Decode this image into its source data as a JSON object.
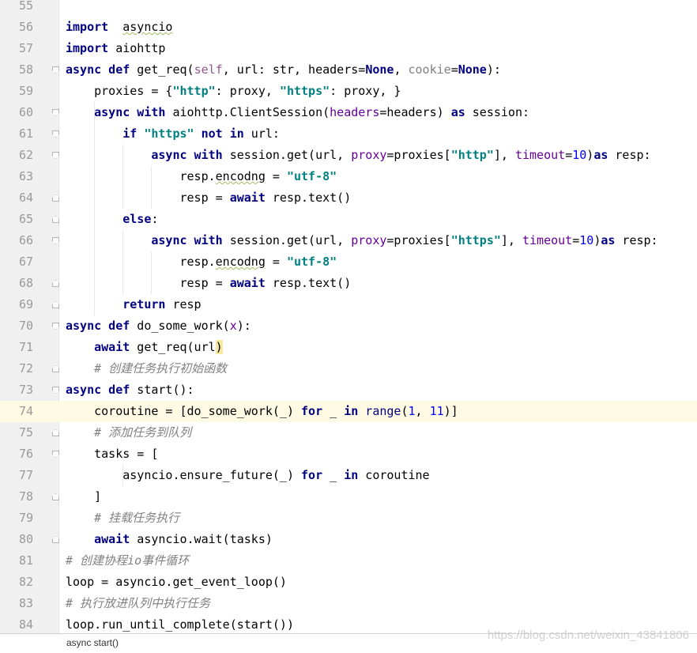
{
  "editor": {
    "current_line": 74,
    "lines": [
      {
        "n": "55",
        "segs": []
      },
      {
        "n": "56",
        "segs": [
          [
            "kw",
            "import"
          ],
          [
            "",
            "  "
          ],
          [
            "squig",
            "asyncio"
          ]
        ]
      },
      {
        "n": "57",
        "segs": [
          [
            "kw",
            "import"
          ],
          [
            "",
            " aiohttp"
          ]
        ]
      },
      {
        "n": "58",
        "segs": [
          [
            "kw",
            "async def"
          ],
          [
            "",
            " get_req("
          ],
          [
            "self",
            "self"
          ],
          [
            "",
            ", url: str, headers="
          ],
          [
            "kw",
            "None"
          ],
          [
            "",
            ", "
          ],
          [
            "grey",
            "cookie"
          ],
          [
            "",
            "="
          ],
          [
            "kw",
            "None"
          ],
          [
            "",
            "):"
          ]
        ]
      },
      {
        "n": "59",
        "segs": [
          [
            "",
            "    proxies = {"
          ],
          [
            "str",
            "\"http\""
          ],
          [
            "",
            ": proxy, "
          ],
          [
            "str",
            "\"https\""
          ],
          [
            "",
            ": proxy, }"
          ]
        ]
      },
      {
        "n": "60",
        "segs": [
          [
            "",
            "    "
          ],
          [
            "kw",
            "async with"
          ],
          [
            "",
            " aiohttp.ClientSession("
          ],
          [
            "param",
            "headers"
          ],
          [
            "",
            "=headers) "
          ],
          [
            "kw",
            "as"
          ],
          [
            "",
            " session:"
          ]
        ]
      },
      {
        "n": "61",
        "segs": [
          [
            "",
            "        "
          ],
          [
            "kw",
            "if"
          ],
          [
            "",
            " "
          ],
          [
            "str",
            "\"https\""
          ],
          [
            "",
            " "
          ],
          [
            "kw",
            "not in"
          ],
          [
            "",
            " url:"
          ]
        ]
      },
      {
        "n": "62",
        "segs": [
          [
            "",
            "            "
          ],
          [
            "kw",
            "async with"
          ],
          [
            "",
            " session.get(url, "
          ],
          [
            "param",
            "proxy"
          ],
          [
            "",
            "=proxies["
          ],
          [
            "str",
            "\"http\""
          ],
          [
            "",
            "], "
          ],
          [
            "param",
            "timeout"
          ],
          [
            "",
            "="
          ],
          [
            "num",
            "10"
          ],
          [
            "",
            ")"
          ],
          [
            "kw",
            "as"
          ],
          [
            "",
            " resp:"
          ]
        ]
      },
      {
        "n": "63",
        "segs": [
          [
            "",
            "                resp."
          ],
          [
            "squig",
            "encodng"
          ],
          [
            "",
            " = "
          ],
          [
            "str",
            "\"utf-8\""
          ]
        ]
      },
      {
        "n": "64",
        "segs": [
          [
            "",
            "                resp = "
          ],
          [
            "kw",
            "await"
          ],
          [
            "",
            " resp.text()"
          ]
        ]
      },
      {
        "n": "65",
        "segs": [
          [
            "",
            "        "
          ],
          [
            "kw",
            "else"
          ],
          [
            "",
            ":"
          ]
        ]
      },
      {
        "n": "66",
        "segs": [
          [
            "",
            "            "
          ],
          [
            "kw",
            "async with"
          ],
          [
            "",
            " session.get(url, "
          ],
          [
            "param",
            "proxy"
          ],
          [
            "",
            "=proxies["
          ],
          [
            "str",
            "\"https\""
          ],
          [
            "",
            "], "
          ],
          [
            "param",
            "timeout"
          ],
          [
            "",
            "="
          ],
          [
            "num",
            "10"
          ],
          [
            "",
            ")"
          ],
          [
            "kw",
            "as"
          ],
          [
            "",
            " resp:"
          ]
        ]
      },
      {
        "n": "67",
        "segs": [
          [
            "",
            "                resp."
          ],
          [
            "squig",
            "encodng"
          ],
          [
            "",
            " = "
          ],
          [
            "str",
            "\"utf-8\""
          ]
        ]
      },
      {
        "n": "68",
        "segs": [
          [
            "",
            "                resp = "
          ],
          [
            "kw",
            "await"
          ],
          [
            "",
            " resp.text()"
          ]
        ]
      },
      {
        "n": "69",
        "segs": [
          [
            "",
            "        "
          ],
          [
            "kw",
            "return"
          ],
          [
            "",
            " resp"
          ]
        ]
      },
      {
        "n": "70",
        "segs": [
          [
            "kw",
            "async def"
          ],
          [
            "",
            " do_some_work("
          ],
          [
            "param",
            "x"
          ],
          [
            "",
            "):"
          ]
        ]
      },
      {
        "n": "71",
        "segs": [
          [
            "",
            "    "
          ],
          [
            "kw",
            "await"
          ],
          [
            "",
            " get_req(url"
          ],
          [
            "paren-hl",
            ")"
          ]
        ]
      },
      {
        "n": "72",
        "segs": [
          [
            "cmt",
            "    # 创建任务执行初始函数"
          ]
        ]
      },
      {
        "n": "73",
        "segs": [
          [
            "kw",
            "async def"
          ],
          [
            "",
            " start():"
          ]
        ]
      },
      {
        "n": "74",
        "segs": [
          [
            "",
            "    coroutine = [do_some_work(_) "
          ],
          [
            "kw",
            "for"
          ],
          [
            "",
            " _ "
          ],
          [
            "kw",
            "in"
          ],
          [
            "",
            " "
          ],
          [
            "kw2",
            "range"
          ],
          [
            "",
            "("
          ],
          [
            "num",
            "1"
          ],
          [
            "",
            ", "
          ],
          [
            "num",
            "11"
          ],
          [
            "",
            ")]"
          ]
        ]
      },
      {
        "n": "75",
        "segs": [
          [
            "cmt",
            "    # 添加任务到队列"
          ]
        ]
      },
      {
        "n": "76",
        "segs": [
          [
            "",
            "    tasks = ["
          ]
        ]
      },
      {
        "n": "77",
        "segs": [
          [
            "",
            "        asyncio.ensure_future(_) "
          ],
          [
            "kw",
            "for"
          ],
          [
            "",
            " _ "
          ],
          [
            "kw",
            "in"
          ],
          [
            "",
            " coroutine"
          ]
        ]
      },
      {
        "n": "78",
        "segs": [
          [
            "",
            "    ]"
          ]
        ]
      },
      {
        "n": "79",
        "segs": [
          [
            "cmt",
            "    # 挂载任务执行"
          ]
        ]
      },
      {
        "n": "80",
        "segs": [
          [
            "",
            "    "
          ],
          [
            "kw",
            "await"
          ],
          [
            "",
            " asyncio.wait(tasks)"
          ]
        ]
      },
      {
        "n": "81",
        "segs": [
          [
            "cmt",
            "# 创建协程io事件循环"
          ]
        ]
      },
      {
        "n": "82",
        "segs": [
          [
            "",
            "loop = asyncio.get_event_loop()"
          ]
        ]
      },
      {
        "n": "83",
        "segs": [
          [
            "cmt",
            "# 执行放进队列中执行任务"
          ]
        ]
      },
      {
        "n": "84",
        "segs": [
          [
            "",
            "loop.run_until_complete(start())"
          ]
        ]
      }
    ]
  },
  "statusbar": {
    "breadcrumb": "async start()"
  },
  "watermark": "https://blog.csdn.net/weixin_43841806",
  "colors": {
    "keyword": "#000080",
    "string": "#008080",
    "number": "#0000ff",
    "param": "#660099",
    "comment": "#808080",
    "current_line": "#fffae3"
  }
}
